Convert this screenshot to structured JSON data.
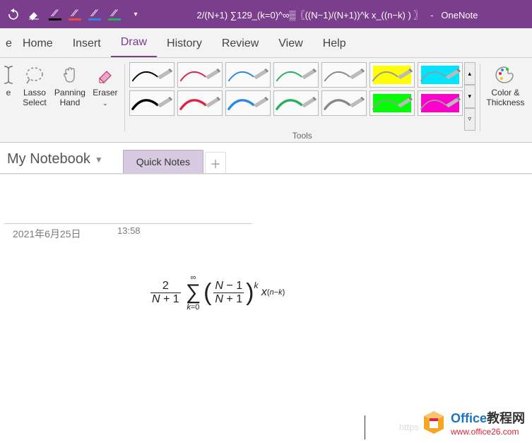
{
  "titlebar": {
    "doc_formula": "2/(N+1) ∑129_(k=0)^∞▒〖((N−1)/(N+1))^k x_((n−k) ) 〗",
    "app_name": "OneNote",
    "highlighters": [
      {
        "color": "#000000"
      },
      {
        "color": "#e74c3c"
      },
      {
        "color": "#2e86de"
      },
      {
        "color": "#27ae60"
      }
    ]
  },
  "tabs": {
    "items": [
      "e",
      "Home",
      "Insert",
      "Draw",
      "History",
      "Review",
      "View",
      "Help"
    ],
    "active": "Draw"
  },
  "ribbon": {
    "type_label": "e",
    "lasso_label": "Lasso\nSelect",
    "panning_label": "Panning\nHand",
    "eraser_label": "Eraser",
    "tools_group": "Tools",
    "color_thickness": "Color &\nThickness",
    "pens_row1": [
      {
        "stroke": "#000000",
        "hl": null
      },
      {
        "stroke": "#d24",
        "hl": null
      },
      {
        "stroke": "#2e86de",
        "hl": null
      },
      {
        "stroke": "#27ae60",
        "hl": null
      },
      {
        "stroke": "#888",
        "hl": null
      },
      {
        "stroke": "#888",
        "hl": "#ffff00"
      },
      {
        "stroke": "#888",
        "hl": "#00e5ff"
      }
    ],
    "pens_row2": [
      {
        "stroke": "#000000",
        "hl": null
      },
      {
        "stroke": "#d24",
        "hl": null
      },
      {
        "stroke": "#2e86de",
        "hl": null
      },
      {
        "stroke": "#27ae60",
        "hl": null
      },
      {
        "stroke": "#888",
        "hl": null
      },
      {
        "stroke": "#888",
        "hl": "#00ff00"
      },
      {
        "stroke": "#888",
        "hl": "#ff00cc"
      }
    ]
  },
  "notebook": {
    "name": "My Notebook",
    "page_tab": "Quick Notes"
  },
  "page": {
    "date": "2021年6月25日",
    "time": "13:58",
    "equation_plain": "2/(N+1) Σ_{k=0}^{∞} ((N−1)/(N+1))^k x_{(n−k)}"
  },
  "watermark": {
    "ghost": "https",
    "brand_en": "Office",
    "brand_cn": "教程网",
    "url": "www.office26.com"
  }
}
